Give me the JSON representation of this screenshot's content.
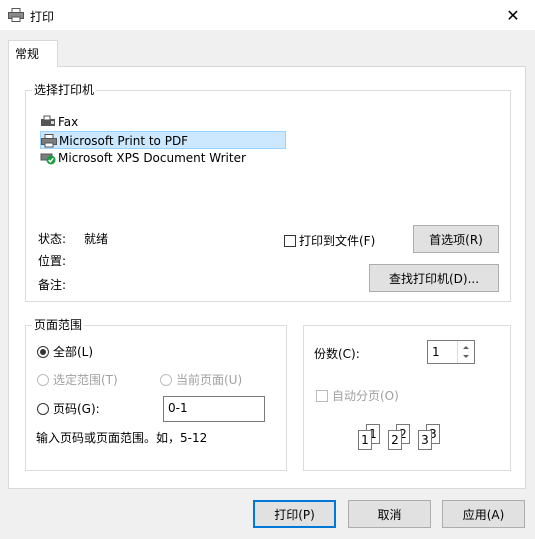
{
  "window": {
    "title": "打印",
    "close_glyph": "✕"
  },
  "tabs": [
    {
      "label": "常规"
    }
  ],
  "select_printer": {
    "group_label": "选择打印机",
    "printers": [
      {
        "name": "Fax",
        "icon": "fax-icon",
        "selected": false
      },
      {
        "name": "Microsoft Print to PDF",
        "icon": "printer-icon",
        "selected": true
      },
      {
        "name": "Microsoft XPS Document Writer",
        "icon": "printer-check-icon",
        "selected": false
      }
    ],
    "status_label": "状态:",
    "status_value": "就绪",
    "location_label": "位置:",
    "comment_label": "备注:",
    "print_to_file_label": "打印到文件(F)",
    "print_to_file_checked": false,
    "preferences_button": "首选项(R)",
    "find_printer_button": "查找打印机(D)..."
  },
  "page_range": {
    "group_label": "页面范围",
    "all_label": "全部(L)",
    "selection_label": "选定范围(T)",
    "current_page_label": "当前页面(U)",
    "pages_label": "页码(G):",
    "pages_value": "0-1",
    "hint": "输入页码或页面范围。如，5-12",
    "selected_option": "all"
  },
  "copies": {
    "label": "份数(C):",
    "value": "1",
    "collate_label": "自动分页(O)",
    "collate_checked": false,
    "collate_icon": "collate-pages-icon",
    "collate_digits": [
      "1",
      "1",
      "2",
      "2",
      "3",
      "3"
    ]
  },
  "footer": {
    "print_button": "打印(P)",
    "cancel_button": "取消",
    "apply_button": "应用(A)"
  },
  "colors": {
    "selection_bg": "#cce8ff",
    "selection_border": "#99d1ff",
    "primary_border": "#0078d7",
    "check_green": "#1a9c3e"
  }
}
